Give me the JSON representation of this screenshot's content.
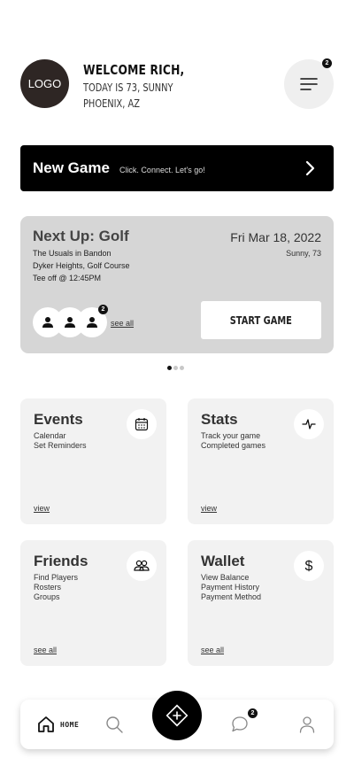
{
  "header": {
    "logo_text": "LOGO",
    "welcome": "WELCOME RICH,",
    "weather_line": "TODAY IS 73, SUNNY",
    "location": "PHOENIX, AZ",
    "menu_badge": "2",
    "menu_icon": "hamburger-menu-icon"
  },
  "new_game": {
    "title": "New Game",
    "subtitle": "Click. Connect. Let's go!",
    "icon": "chevron-right-icon"
  },
  "next_up": {
    "title": "Next Up: Golf",
    "group": "The Usuals in Bandon",
    "course": "Dyker Heights, Golf Course",
    "tee_time": "Tee off @ 12:45PM",
    "date": "Fri Mar 18, 2022",
    "weather": "Sunny, 73",
    "players_badge": "2",
    "see_all": "see all",
    "start_button": "START GAME"
  },
  "carousel": {
    "count": 3,
    "active_index": 0
  },
  "tiles": {
    "events": {
      "title": "Events",
      "lines": [
        "Calendar",
        "Set Reminders"
      ],
      "link": "view",
      "icon": "calendar-icon"
    },
    "stats": {
      "title": "Stats",
      "lines": [
        "Track your game",
        "Completed games"
      ],
      "link": "view",
      "icon": "activity-pulse-icon"
    },
    "friends": {
      "title": "Friends",
      "lines": [
        "Find Players",
        "Rosters",
        "Groups"
      ],
      "link": "see all",
      "icon": "people-icon"
    },
    "wallet": {
      "title": "Wallet",
      "lines": [
        "View Balance",
        "Payment History",
        "Payment Method"
      ],
      "link": "see all",
      "icon": "dollar-icon"
    }
  },
  "bottom_nav": {
    "home_label": "HOME",
    "messages_badge": "2",
    "items": [
      "home-icon",
      "search-icon",
      "add-game-icon",
      "chat-icon",
      "profile-icon"
    ]
  },
  "colors": {
    "primary": "#000000",
    "card": "#d6d6d6",
    "tile": "#f2f2f2",
    "logo": "#2e2624"
  }
}
